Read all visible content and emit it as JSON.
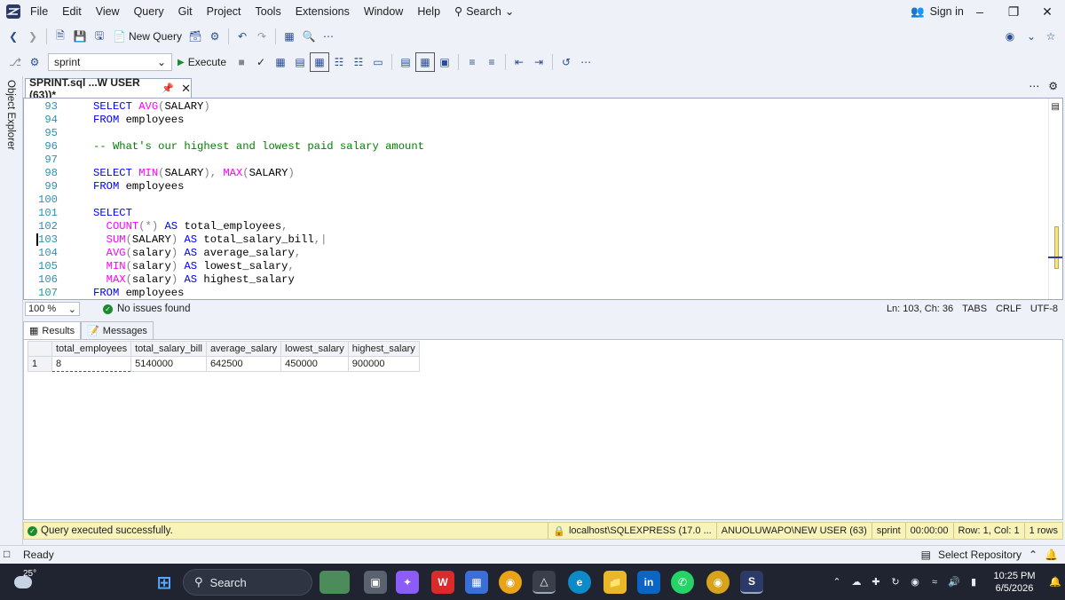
{
  "menu": {
    "items": [
      "File",
      "Edit",
      "View",
      "Query",
      "Git",
      "Project",
      "Tools",
      "Extensions",
      "Window",
      "Help"
    ],
    "search_label": "Search",
    "sign_in": "Sign in"
  },
  "toolbar": {
    "new_query": "New Query",
    "database": "sprint",
    "execute": "Execute"
  },
  "sidebar": {
    "object_explorer": "Object Explorer"
  },
  "document_tab": {
    "title": "SPRINT.sql ...W USER (63))*"
  },
  "editor": {
    "lines": [
      {
        "n": "93",
        "tokens": [
          {
            "t": "SELECT ",
            "c": "kw"
          },
          {
            "t": "AVG",
            "c": "fn"
          },
          {
            "t": "(",
            "c": "gr"
          },
          {
            "t": "SALARY",
            "c": "tx"
          },
          {
            "t": ")",
            "c": "gr"
          }
        ]
      },
      {
        "n": "94",
        "tokens": [
          {
            "t": "FROM ",
            "c": "kw"
          },
          {
            "t": "employees",
            "c": "tx"
          }
        ]
      },
      {
        "n": "95",
        "tokens": []
      },
      {
        "n": "96",
        "tokens": [
          {
            "t": "-- What's our highest and lowest paid salary amount",
            "c": "cm"
          }
        ]
      },
      {
        "n": "97",
        "tokens": []
      },
      {
        "n": "98",
        "tokens": [
          {
            "t": "SELECT ",
            "c": "kw"
          },
          {
            "t": "MIN",
            "c": "fn"
          },
          {
            "t": "(",
            "c": "gr"
          },
          {
            "t": "SALARY",
            "c": "tx"
          },
          {
            "t": "), ",
            "c": "gr"
          },
          {
            "t": "MAX",
            "c": "fn"
          },
          {
            "t": "(",
            "c": "gr"
          },
          {
            "t": "SALARY",
            "c": "tx"
          },
          {
            "t": ")",
            "c": "gr"
          }
        ]
      },
      {
        "n": "99",
        "tokens": [
          {
            "t": "FROM ",
            "c": "kw"
          },
          {
            "t": "employees",
            "c": "tx"
          }
        ]
      },
      {
        "n": "100",
        "tokens": []
      },
      {
        "n": "101",
        "tokens": [
          {
            "t": "SELECT",
            "c": "kw"
          }
        ]
      },
      {
        "n": "102",
        "tokens": [
          {
            "t": "  ",
            "c": "tx"
          },
          {
            "t": "COUNT",
            "c": "fn"
          },
          {
            "t": "(*) ",
            "c": "gr"
          },
          {
            "t": "AS ",
            "c": "kw"
          },
          {
            "t": "total_employees",
            "c": "tx"
          },
          {
            "t": ",",
            "c": "gr"
          }
        ]
      },
      {
        "n": "103",
        "tokens": [
          {
            "t": "  ",
            "c": "tx"
          },
          {
            "t": "SUM",
            "c": "fn"
          },
          {
            "t": "(",
            "c": "gr"
          },
          {
            "t": "SALARY",
            "c": "tx"
          },
          {
            "t": ") ",
            "c": "gr"
          },
          {
            "t": "AS ",
            "c": "kw"
          },
          {
            "t": "total_salary_bill",
            "c": "tx"
          },
          {
            "t": ",|",
            "c": "gr"
          }
        ]
      },
      {
        "n": "104",
        "tokens": [
          {
            "t": "  ",
            "c": "tx"
          },
          {
            "t": "AVG",
            "c": "fn"
          },
          {
            "t": "(",
            "c": "gr"
          },
          {
            "t": "salary",
            "c": "tx"
          },
          {
            "t": ") ",
            "c": "gr"
          },
          {
            "t": "AS ",
            "c": "kw"
          },
          {
            "t": "average_salary",
            "c": "tx"
          },
          {
            "t": ",",
            "c": "gr"
          }
        ]
      },
      {
        "n": "105",
        "tokens": [
          {
            "t": "  ",
            "c": "tx"
          },
          {
            "t": "MIN",
            "c": "fn"
          },
          {
            "t": "(",
            "c": "gr"
          },
          {
            "t": "salary",
            "c": "tx"
          },
          {
            "t": ") ",
            "c": "gr"
          },
          {
            "t": "AS ",
            "c": "kw"
          },
          {
            "t": "lowest_salary",
            "c": "tx"
          },
          {
            "t": ",",
            "c": "gr"
          }
        ]
      },
      {
        "n": "106",
        "tokens": [
          {
            "t": "  ",
            "c": "tx"
          },
          {
            "t": "MAX",
            "c": "fn"
          },
          {
            "t": "(",
            "c": "gr"
          },
          {
            "t": "salary",
            "c": "tx"
          },
          {
            "t": ") ",
            "c": "gr"
          },
          {
            "t": "AS ",
            "c": "kw"
          },
          {
            "t": "highest_salary",
            "c": "tx"
          }
        ]
      },
      {
        "n": "107",
        "tokens": [
          {
            "t": "FROM ",
            "c": "kw"
          },
          {
            "t": "employees",
            "c": "tx"
          }
        ]
      }
    ],
    "current_line": "103"
  },
  "editor_status": {
    "zoom": "100 %",
    "issues": "No issues found",
    "position": "Ln: 103, Ch: 36",
    "indent": "TABS",
    "line_ending": "CRLF",
    "encoding": "UTF-8"
  },
  "results_tabs": {
    "results": "Results",
    "messages": "Messages"
  },
  "results": {
    "columns": [
      "total_employees",
      "total_salary_bill",
      "average_salary",
      "lowest_salary",
      "highest_salary"
    ],
    "rows": [
      {
        "row": "1",
        "cells": [
          "8",
          "5140000",
          "642500",
          "450000",
          "900000"
        ]
      }
    ]
  },
  "query_status": {
    "message": "Query executed successfully.",
    "server": "localhost\\SQLEXPRESS (17.0 ...",
    "user": "ANUOLUWAPO\\NEW USER (63)",
    "database": "sprint",
    "elapsed": "00:00:00",
    "cursor": "Row: 1, Col: 1",
    "rows": "1 rows"
  },
  "app_status": {
    "ready": "Ready",
    "repository": "Select Repository"
  },
  "taskbar": {
    "temperature": "25°",
    "search": "Search",
    "time": "10:25 PM",
    "date": "6/5/2026"
  },
  "colors": {
    "keyword": "#0000ff",
    "function": "#ff00ff",
    "comment": "#008000",
    "line_number": "#2b91af",
    "status_yellow": "#f7f3b9",
    "taskbar": "#1f2430"
  }
}
